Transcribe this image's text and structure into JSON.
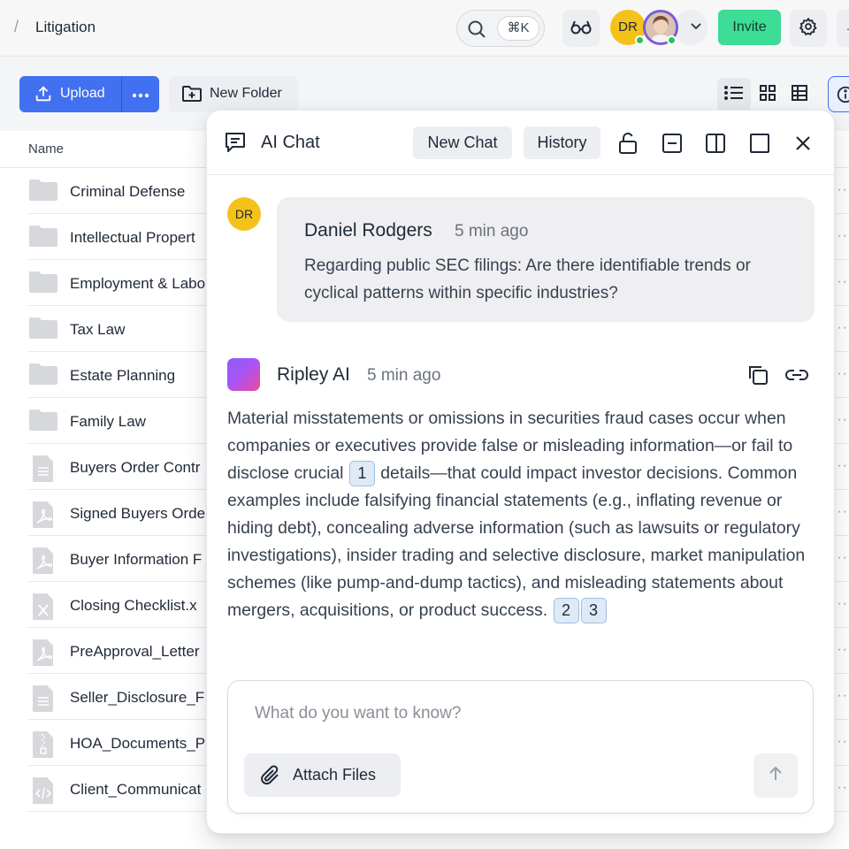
{
  "topbar": {
    "breadcrumb_separator": "/",
    "breadcrumb_title": "Litigation",
    "search_shortcut": "⌘K",
    "user_initials": "DR",
    "invite_label": "Invite"
  },
  "toolbar": {
    "upload_label": "Upload",
    "new_folder_label": "New Folder"
  },
  "list": {
    "column_name": "Name",
    "rows": [
      {
        "name": "Criminal Defense",
        "type": "folder"
      },
      {
        "name": "Intellectual Propert",
        "type": "folder"
      },
      {
        "name": "Employment & Labo",
        "type": "folder"
      },
      {
        "name": "Tax Law",
        "type": "folder"
      },
      {
        "name": "Estate Planning",
        "type": "folder"
      },
      {
        "name": "Family Law",
        "type": "folder"
      },
      {
        "name": "Buyers Order Contr",
        "type": "doc"
      },
      {
        "name": "Signed Buyers Orde",
        "type": "pdf"
      },
      {
        "name": "Buyer Information F",
        "type": "pdf"
      },
      {
        "name": "Closing Checklist.x",
        "type": "xls"
      },
      {
        "name": "PreApproval_Letter",
        "type": "pdf"
      },
      {
        "name": "Seller_Disclosure_F",
        "type": "doc"
      },
      {
        "name": "HOA_Documents_P",
        "type": "zip"
      },
      {
        "name": "Client_Communicat",
        "type": "code"
      }
    ],
    "row_more": "···"
  },
  "chat": {
    "title": "AI Chat",
    "new_chat_label": "New Chat",
    "history_label": "History",
    "user_message": {
      "initials": "DR",
      "name": "Daniel Rodgers",
      "time": "5 min ago",
      "text": "Regarding public SEC filings: Are there identifiable trends or cyclical patterns within specific industries?"
    },
    "ai_message": {
      "name": "Ripley AI",
      "time": "5 min ago",
      "text_part1": "Material misstatements or omissions in securities fraud cases occur when companies or executives provide false or misleading information—or fail to disclose crucial",
      "citation1": "1",
      "text_part2": "details—that could impact investor decisions. Common examples include falsifying financial statements (e.g., inflating revenue or hiding debt), concealing adverse information (such as lawsuits or regulatory investigations), insider trading and selective disclosure, market manipulation schemes (like pump-and-dump tactics), and misleading statements about mergers, acquisitions, or product success.",
      "citation2": "2",
      "citation3": "3"
    },
    "composer": {
      "placeholder": "What do you want to know?",
      "attach_label": "Attach Files"
    }
  },
  "colors": {
    "primary": "#4170f0",
    "invite": "#3ddc97",
    "avatar_yellow": "#f5c21b",
    "citation_bg": "#dfeaf6"
  }
}
